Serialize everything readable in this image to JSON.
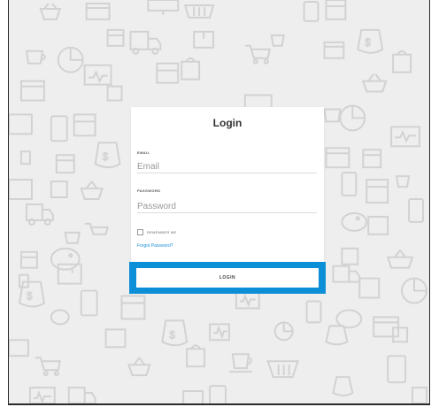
{
  "login": {
    "title": "Login",
    "email_label": "EMAIL",
    "email_placeholder": "Email",
    "password_label": "PASSWORD",
    "password_placeholder": "Password",
    "remember_label": "REMEMBER ME",
    "forgot_link": "Forgot Password?",
    "button_label": "LOGIN"
  },
  "background": {
    "pattern_icons": [
      "calendar-icon",
      "truck-icon",
      "money-bag-icon",
      "shopping-bag-icon",
      "shopping-cart-icon",
      "basket-icon",
      "piggy-bank-icon",
      "coffee-cup-icon",
      "pie-chart-icon",
      "monitor-icon",
      "tablet-icon",
      "box-icon",
      "browser-window-icon",
      "wallet-icon"
    ],
    "colors": {
      "background": "#eeeeee",
      "icon_stroke": "#d2d2d2",
      "accent": "#0d8fd8",
      "link": "#1a8fd6"
    }
  }
}
